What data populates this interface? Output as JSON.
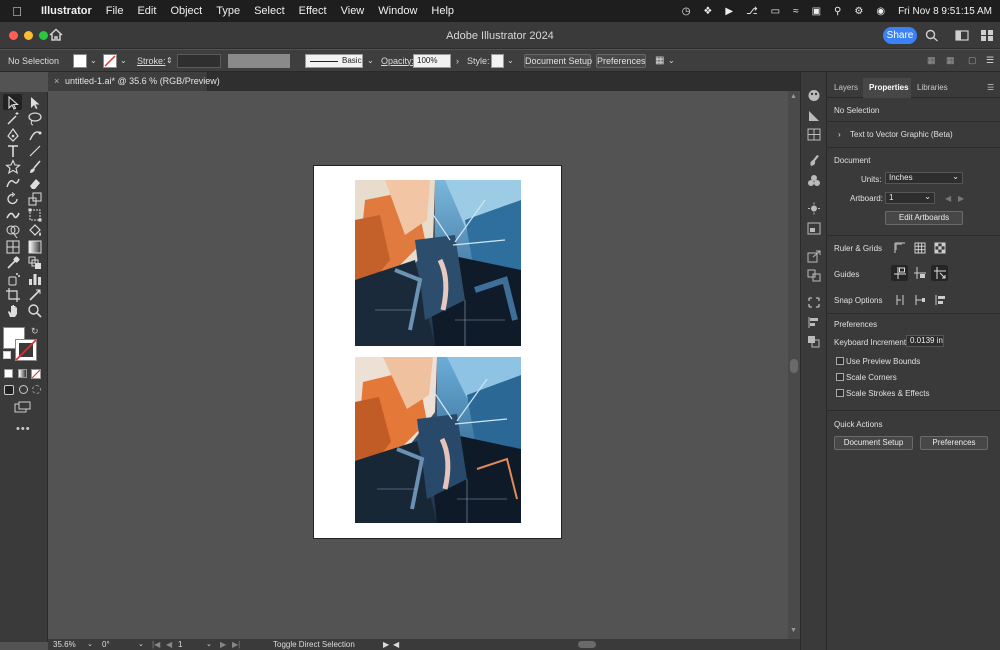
{
  "menubar": {
    "app_name": "Illustrator",
    "items": [
      "File",
      "Edit",
      "Object",
      "Type",
      "Select",
      "Effect",
      "View",
      "Window",
      "Help"
    ],
    "datetime": "Fri Nov 8  9:51:15 AM"
  },
  "titlebar": {
    "title": "Adobe Illustrator 2024",
    "share_label": "Share"
  },
  "controlbar": {
    "selection": "No Selection",
    "stroke_label": "Stroke:",
    "brush_label": "Basic",
    "opacity_label": "Opacity:",
    "opacity_value": "100%",
    "style_label": "Style:",
    "document_setup_label": "Document Setup",
    "preferences_label": "Preferences"
  },
  "document": {
    "tab_title": "untitled-1.ai* @ 35.6 % (RGB/Preview)"
  },
  "statusbar": {
    "zoom": "35.6%",
    "rotation": "0°",
    "artboard_number": "1",
    "tool_hint": "Toggle Direct Selection"
  },
  "panel": {
    "tabs": [
      "Layers",
      "Properties",
      "Libraries"
    ],
    "active_tab": "Properties",
    "selection_status": "No Selection",
    "text_to_vector": "Text to Vector Graphic (Beta)",
    "document_header": "Document",
    "units_label": "Units:",
    "units_value": "Inches",
    "artboard_label": "Artboard:",
    "artboard_value": "1",
    "edit_artboards_label": "Edit Artboards",
    "ruler_grids_label": "Ruler & Grids",
    "guides_label": "Guides",
    "snap_options_label": "Snap Options",
    "preferences_header": "Preferences",
    "keyboard_increment_label": "Keyboard Increment:",
    "keyboard_increment_value": "0.0139 in",
    "use_preview_bounds_label": "Use Preview Bounds",
    "scale_corners_label": "Scale Corners",
    "scale_strokes_label": "Scale Strokes & Effects",
    "quick_actions_header": "Quick Actions",
    "qa_document_setup_label": "Document Setup",
    "qa_preferences_label": "Preferences"
  },
  "colors": {
    "accent_share": "#3b82f6",
    "traffic_red": "#ff5f57",
    "traffic_yellow": "#febc2e",
    "traffic_green": "#28c840"
  }
}
